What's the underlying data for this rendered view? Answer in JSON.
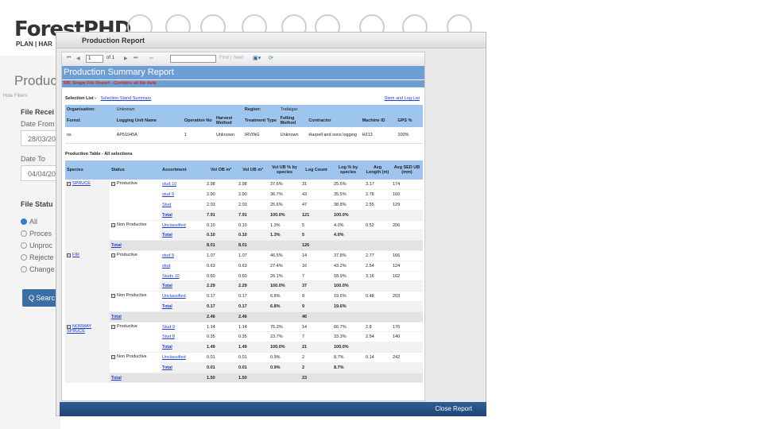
{
  "app": {
    "logo": "ForestPHD",
    "logo_sub": "PLAN | HAR"
  },
  "sidebar": {
    "title": "Product",
    "hide_filters": "Hide Filters",
    "file_received": "File Recei",
    "date_from_label": "Date From",
    "date_from_value": "28/03/20",
    "date_to_label": "Date To",
    "date_to_value": "04/04/20",
    "file_status": "File Statu",
    "radios": [
      {
        "label": "All",
        "selected": true
      },
      {
        "label": "Proces",
        "selected": false
      },
      {
        "label": "Unproc",
        "selected": false
      },
      {
        "label": "Rejecte",
        "selected": false
      },
      {
        "label": "Change",
        "selected": false
      }
    ],
    "search_button": "Q Searc"
  },
  "dialog": {
    "title": "Production Report",
    "close_button": "Close Report",
    "toolbar": {
      "first": "⏮",
      "prev": "◀",
      "page": "1",
      "of": "of 1",
      "next": "▶",
      "last": "⏭",
      "back": "⇦",
      "find": "Find",
      "next_find": "Next"
    },
    "report_title": "Production Summary Report",
    "note": "NB: Single File Report - Contains all file data",
    "selection_list_label": "Selection List -",
    "selection_stand_summary": "Selection Stand Summary",
    "stem_log_list": "Stem and Log List",
    "info": {
      "org_label": "Organisation:",
      "org_value": "Unknown",
      "region_label": "Region:",
      "region_value": "Trafalgar",
      "headers": [
        "Forest",
        "Logging Unit Name",
        "Operation No",
        "Harvest Method",
        "Treatment Type",
        "Felling Method",
        "Contractor",
        "Machine ID",
        "GPS %"
      ],
      "row": [
        "ns",
        "AP51045A",
        "1",
        "Unknown",
        "IRVING",
        "Unknown",
        "Harpell and sons logging",
        "H313",
        "100%"
      ]
    },
    "prod_title": "Production Table - All selections",
    "prod_headers": [
      "Species",
      "Status",
      "Assortment",
      "Vol OB m³",
      "Vol UB m³",
      "Vol UB % by species",
      "Log Count",
      "Log % by species",
      "Avg Length (m)",
      "Avg SED UB (mm)"
    ],
    "species": [
      {
        "name": "SPRUCE",
        "groups": [
          {
            "status": "Productive",
            "rows": [
              [
                "stud 10",
                "2.98",
                "2.98",
                "37.6%",
                "31",
                "25.6%",
                "3.17",
                "174"
              ],
              [
                "stud 9",
                "2.90",
                "2.90",
                "36.7%",
                "43",
                "35.5%",
                "2.78",
                "160"
              ],
              [
                "Stud",
                "2.03",
                "2.03",
                "25.6%",
                "47",
                "38.8%",
                "2.55",
                "129"
              ]
            ],
            "total": [
              "Total",
              "7.91",
              "7.91",
              "100.0%",
              "121",
              "100.0%",
              "",
              ""
            ]
          },
          {
            "status": "Non Productive",
            "rows": [
              [
                "Unclassified",
                "0.10",
                "0.10",
                "1.3%",
                "5",
                "4.0%",
                "0.52",
                "206"
              ]
            ],
            "total": [
              "Total",
              "0.10",
              "0.10",
              "1.3%",
              "5",
              "4.0%",
              "",
              ""
            ]
          }
        ],
        "total": [
          "Total",
          "8.01",
          "8.01",
          "",
          "126",
          "",
          "",
          ""
        ]
      },
      {
        "name": "FIR",
        "groups": [
          {
            "status": "Productive",
            "rows": [
              [
                "stud 9",
                "1.07",
                "1.07",
                "46.5%",
                "14",
                "37.8%",
                "2.77",
                "166"
              ],
              [
                "stud",
                "0.63",
                "0.63",
                "27.4%",
                "16",
                "43.2%",
                "2.54",
                "124"
              ],
              [
                "Studs 10",
                "0.60",
                "0.60",
                "26.1%",
                "7",
                "18.9%",
                "3.16",
                "162"
              ]
            ],
            "total": [
              "Total",
              "2.29",
              "2.29",
              "100.0%",
              "37",
              "100.0%",
              "",
              ""
            ]
          },
          {
            "status": "Non Productive",
            "rows": [
              [
                "Unclassified",
                "0.17",
                "0.17",
                "6.8%",
                "9",
                "19.6%",
                "0.48",
                "203"
              ]
            ],
            "total": [
              "Total",
              "0.17",
              "0.17",
              "6.8%",
              "9",
              "19.6%",
              "",
              ""
            ]
          }
        ],
        "total": [
          "Total",
          "2.46",
          "2.46",
          "",
          "46",
          "",
          "",
          ""
        ]
      },
      {
        "name": "NORWAY SPRUCE",
        "groups": [
          {
            "status": "Productive",
            "rows": [
              [
                "Stud 9",
                "1.14",
                "1.14",
                "76.3%",
                "14",
                "66.7%",
                "2.8",
                "170"
              ],
              [
                "Stud 8",
                "0.35",
                "0.35",
                "23.7%",
                "7",
                "33.3%",
                "2.54",
                "140"
              ]
            ],
            "total": [
              "Total",
              "1.49",
              "1.49",
              "100.0%",
              "21",
              "100.0%",
              "",
              ""
            ]
          },
          {
            "status": "Non Productive",
            "rows": [
              [
                "Unclassified",
                "0.01",
                "0.01",
                "0.9%",
                "2",
                "8.7%",
                "0.14",
                "242"
              ]
            ],
            "total": [
              "Total",
              "0.01",
              "0.01",
              "0.9%",
              "2",
              "8.7%",
              "",
              ""
            ]
          }
        ],
        "total": [
          "Total",
          "1.50",
          "1.50",
          "",
          "23",
          "",
          "",
          ""
        ]
      }
    ]
  }
}
